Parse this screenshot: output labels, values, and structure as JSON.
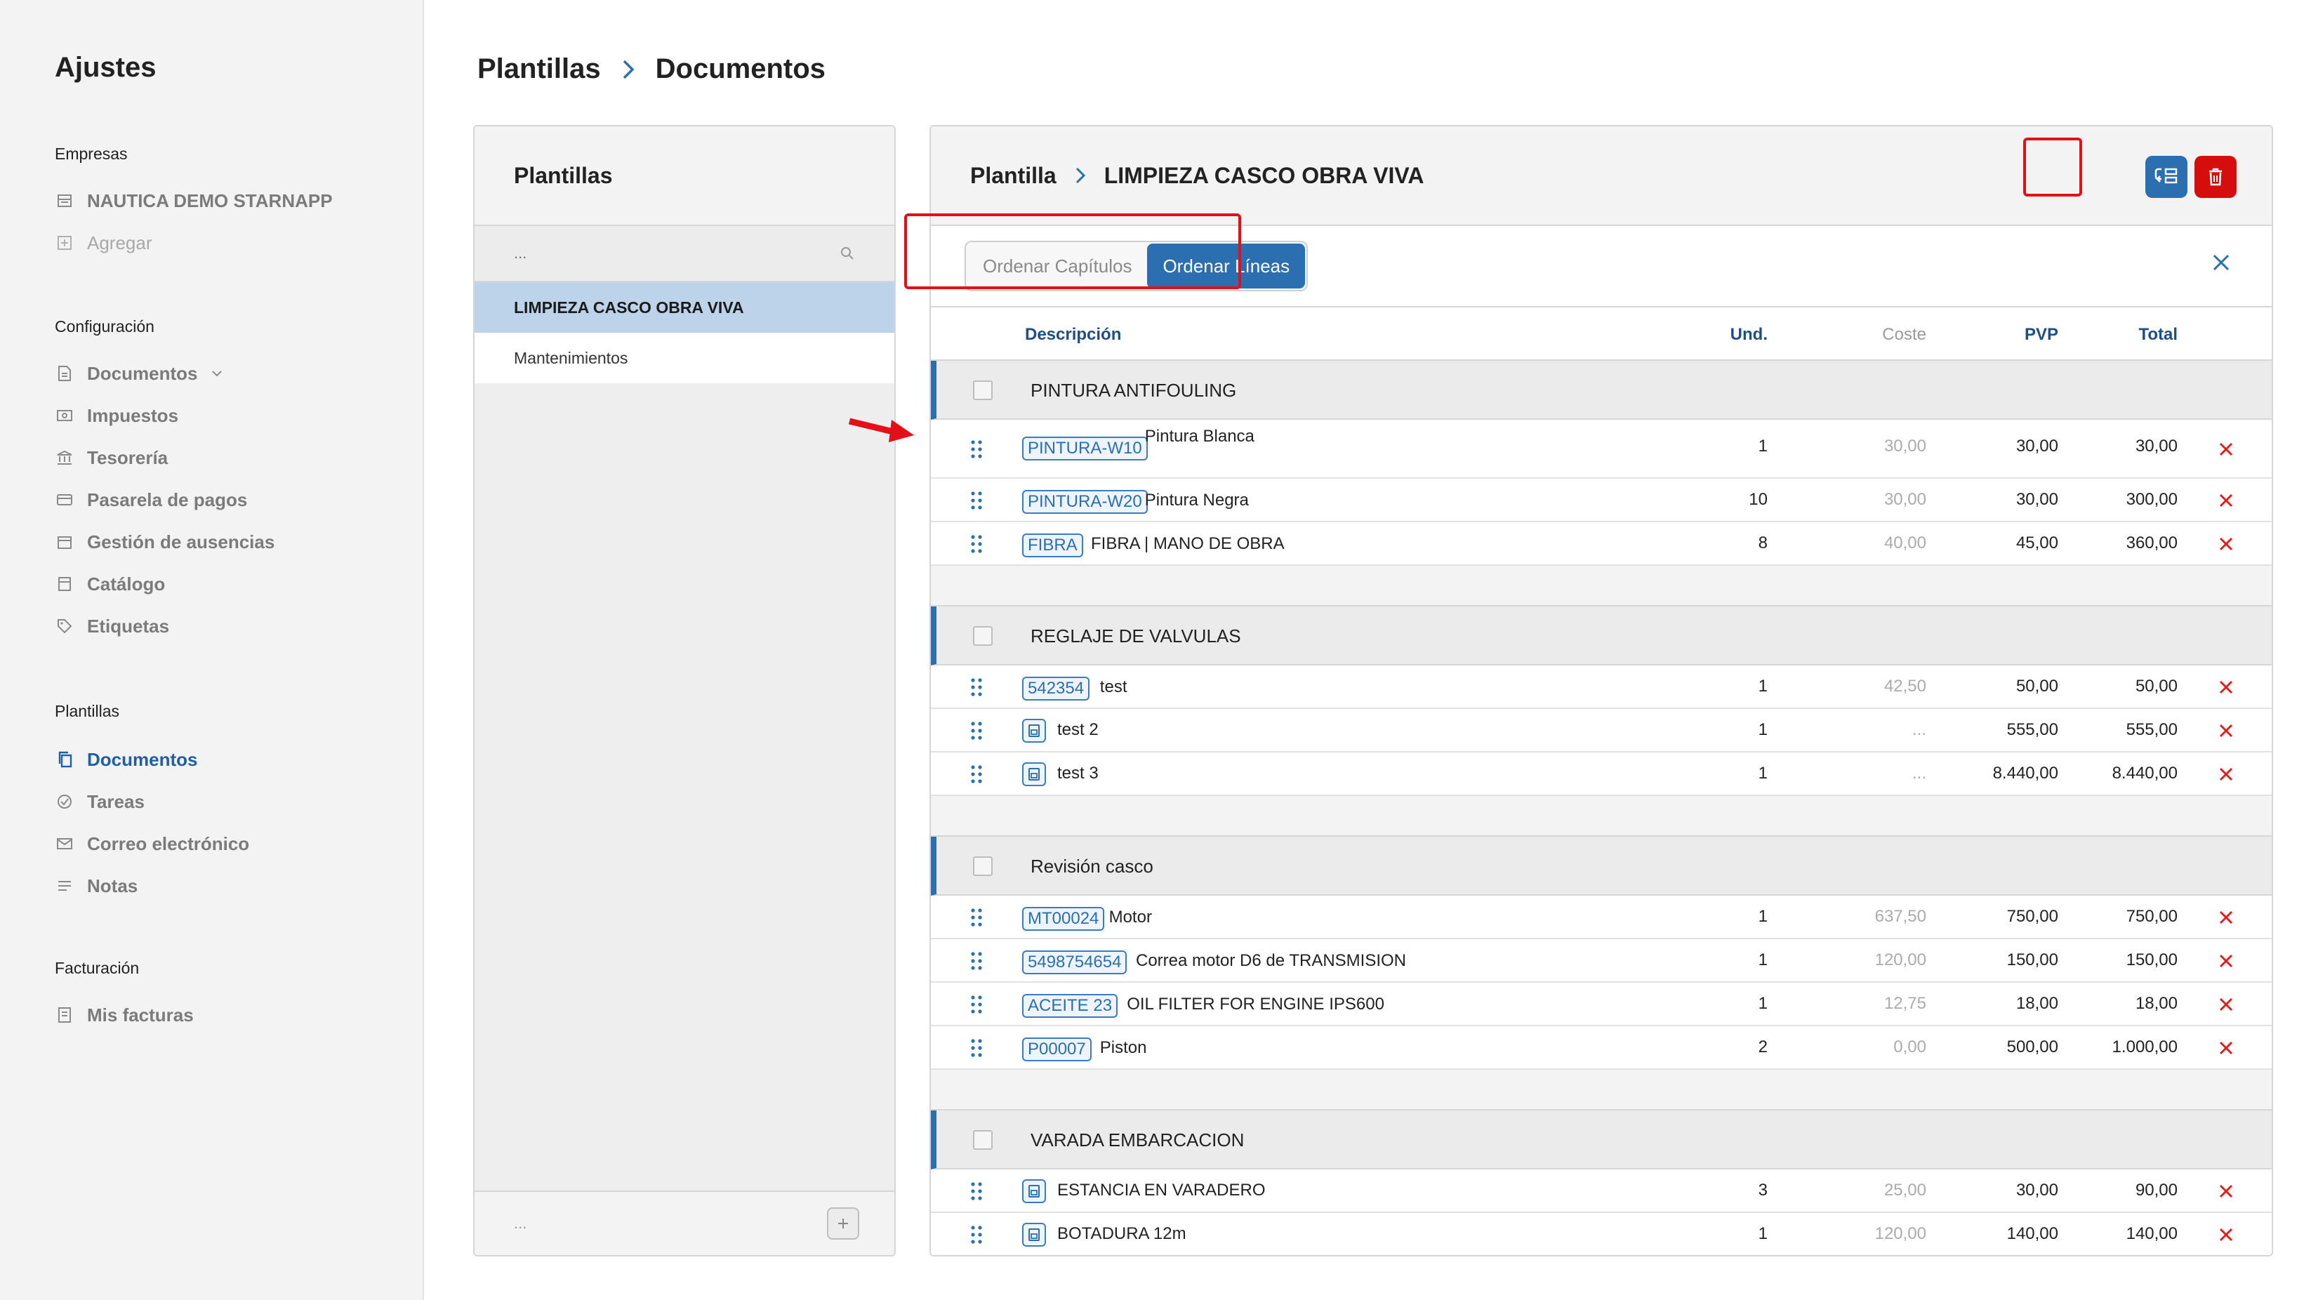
{
  "sidebar": {
    "title": "Ajustes",
    "sections": {
      "empresas": {
        "heading": "Empresas",
        "items": [
          {
            "label": "NAUTICA DEMO STARNAPP",
            "icon": "building-icon"
          },
          {
            "label": "Agregar",
            "icon": "plus-square-icon"
          }
        ]
      },
      "configuracion": {
        "heading": "Configuración",
        "items": [
          {
            "label": "Documentos",
            "icon": "document-icon"
          },
          {
            "label": "Impuestos",
            "icon": "money-icon"
          },
          {
            "label": "Tesorería",
            "icon": "bank-icon"
          },
          {
            "label": "Pasarela de pagos",
            "icon": "payment-icon"
          },
          {
            "label": "Gestión de ausencias",
            "icon": "calendar-icon"
          },
          {
            "label": "Catálogo",
            "icon": "catalog-icon"
          },
          {
            "label": "Etiquetas",
            "icon": "tag-icon"
          }
        ]
      },
      "plantillas": {
        "heading": "Plantillas",
        "items": [
          {
            "label": "Documentos",
            "icon": "copy-icon",
            "active": true
          },
          {
            "label": "Tareas",
            "icon": "check-circle-icon"
          },
          {
            "label": "Correo electrónico",
            "icon": "mail-icon"
          },
          {
            "label": "Notas",
            "icon": "lines-icon"
          }
        ]
      },
      "facturacion": {
        "heading": "Facturación",
        "items": [
          {
            "label": "Mis facturas",
            "icon": "invoice-icon"
          }
        ]
      }
    }
  },
  "breadcrumb": {
    "first": "Plantillas",
    "second": "Documentos"
  },
  "templates_panel": {
    "title": "Plantillas",
    "search_placeholder": "...",
    "items": [
      "LIMPIEZA CASCO OBRA VIVA",
      "Mantenimientos"
    ],
    "footer_text": "..."
  },
  "main": {
    "crumb_first": "Plantilla",
    "crumb_second": "LIMPIEZA CASCO OBRA VIVA",
    "sort_chapters": "Ordenar Capítulos",
    "sort_lines": "Ordenar Líneas",
    "columns": {
      "desc": "Descripción",
      "und": "Und.",
      "coste": "Coste",
      "pvp": "PVP",
      "total": "Total"
    },
    "chapters": [
      {
        "title": "PINTURA ANTIFOULING",
        "lines": [
          {
            "code": "PINTURA-W10",
            "desc": "Pintura Blanca",
            "und": "1",
            "coste": "30,00",
            "pvp": "30,00",
            "total": "30,00"
          },
          {
            "code": "PINTURA-W20",
            "desc": "Pintura Negra",
            "und": "10",
            "coste": "30,00",
            "pvp": "30,00",
            "total": "300,00"
          },
          {
            "code": "FIBRA",
            "desc": "FIBRA | MANO DE OBRA",
            "und": "8",
            "coste": "40,00",
            "pvp": "45,00",
            "total": "360,00"
          }
        ]
      },
      {
        "title": "REGLAJE DE VALVULAS",
        "lines": [
          {
            "code": "542354",
            "desc": "test",
            "und": "1",
            "coste": "42,50",
            "pvp": "50,00",
            "total": "50,00"
          },
          {
            "code": "",
            "desc": "test 2",
            "und": "1",
            "coste": "...",
            "pvp": "555,00",
            "total": "555,00"
          },
          {
            "code": "",
            "desc": "test 3",
            "und": "1",
            "coste": "...",
            "pvp": "8.440,00",
            "total": "8.440,00"
          }
        ]
      },
      {
        "title": "Revisión casco",
        "lines": [
          {
            "code": "MT00024",
            "desc": "Motor",
            "und": "1",
            "coste": "637,50",
            "pvp": "750,00",
            "total": "750,00"
          },
          {
            "code": "5498754654",
            "desc": "Correa motor D6 de TRANSMISION",
            "und": "1",
            "coste": "120,00",
            "pvp": "150,00",
            "total": "150,00"
          },
          {
            "code": "ACEITE 23",
            "desc": "OIL FILTER FOR ENGINE IPS600",
            "und": "1",
            "coste": "12,75",
            "pvp": "18,00",
            "total": "18,00"
          },
          {
            "code": "P00007",
            "desc": "Piston",
            "und": "2",
            "coste": "0,00",
            "pvp": "500,00",
            "total": "1.000,00"
          }
        ]
      },
      {
        "title": "VARADA EMBARCACION",
        "lines": [
          {
            "code": "",
            "desc": "ESTANCIA EN VARADERO",
            "und": "3",
            "coste": "25,00",
            "pvp": "30,00",
            "total": "90,00"
          },
          {
            "code": "",
            "desc": "BOTADURA 12m",
            "und": "1",
            "coste": "120,00",
            "pvp": "140,00",
            "total": "140,00"
          }
        ]
      }
    ]
  },
  "colors": {
    "accent": "#2c6fb0",
    "danger": "#d60d0d",
    "selected_row": "#bdd3ea",
    "annotation": "#e3101a"
  }
}
